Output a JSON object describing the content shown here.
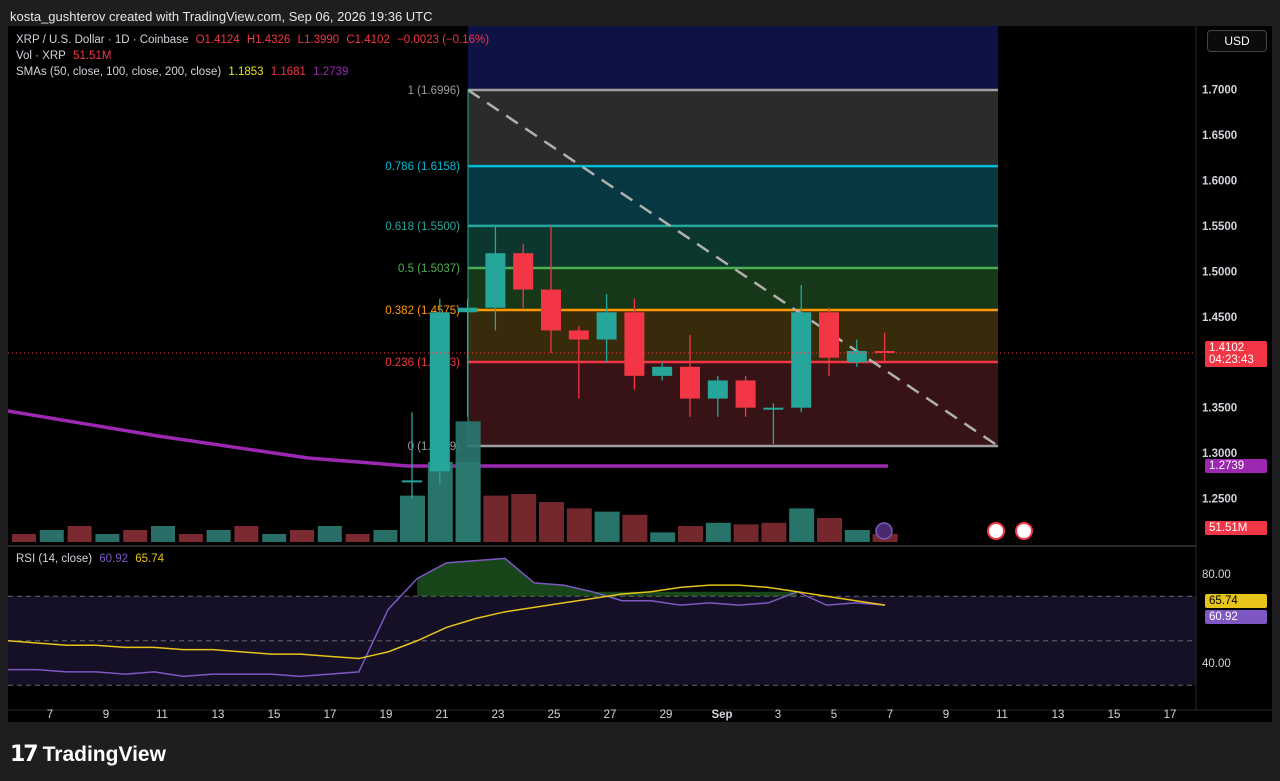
{
  "credit": "kosta_gushterov created with TradingView.com, Sep 06, 2026 19:36 UTC",
  "legend": {
    "symbol": "XRP / U.S. Dollar · 1D · Coinbase",
    "open": "O1.4124",
    "high": "H1.4326",
    "low": "L1.3990",
    "close": "C1.4102",
    "change": "−0.0023 (−0.16%)",
    "vol_label": "Vol · XRP",
    "vol_value": "51.51M",
    "sma_label": "SMAs (50, close, 100, close, 200, close)",
    "sma50": "1.1853",
    "sma100": "1.1681",
    "sma200": "1.2739",
    "rsi_label": "RSI (14, close)",
    "rsi_value": "60.92",
    "rsi_ma": "65.74"
  },
  "currency_button": "USD",
  "price_scale": [
    "1.7000",
    "1.6500",
    "1.6000",
    "1.5500",
    "1.5000",
    "1.4500",
    "1.3500",
    "1.3000",
    "1.2500"
  ],
  "rsi_scale": [
    "80.00",
    "40.00"
  ],
  "price_tags": {
    "last": "1.4102",
    "countdown": "04:23:43",
    "sma200": "1.2739",
    "volume": "51.51M",
    "rsi_ma": "65.74",
    "rsi": "60.92"
  },
  "time_axis": [
    "7",
    "9",
    "11",
    "13",
    "15",
    "17",
    "19",
    "21",
    "23",
    "25",
    "27",
    "29",
    "Sep",
    "3",
    "5",
    "7",
    "9",
    "11",
    "13",
    "15",
    "17"
  ],
  "fib_levels": [
    {
      "label": "1 (1.6996)",
      "price": 1.6996,
      "color": "#9e9e9e"
    },
    {
      "label": "0.786 (1.6158)",
      "price": 1.6158,
      "color": "#00bcd4"
    },
    {
      "label": "0.618 (1.5500)",
      "price": 1.55,
      "color": "#26a69a"
    },
    {
      "label": "0.5 (1.5037)",
      "price": 1.5037,
      "color": "#4caf50"
    },
    {
      "label": "0.382 (1.4575)",
      "price": 1.4575,
      "color": "#ff9800"
    },
    {
      "label": "0.236 (1.4003)",
      "price": 1.4003,
      "color": "#f23645"
    },
    {
      "label": "0 (1.3079)",
      "price": 1.3079,
      "color": "#9e9e9e"
    }
  ],
  "colors": {
    "up": "#26a69a",
    "down": "#f23645",
    "sma200": "#9c27b0",
    "rsi": "#7e57c2",
    "rsi_ma": "#e6c419",
    "background": "#000000"
  },
  "chart_data": {
    "type": "candlestick",
    "candles": [
      {
        "date": "Aug 20",
        "open": 1.27,
        "high": 1.345,
        "low": 1.25,
        "close": 1.27
      },
      {
        "date": "Aug 21",
        "open": 1.28,
        "high": 1.47,
        "low": 1.265,
        "close": 1.455
      },
      {
        "date": "Aug 22",
        "open": 1.455,
        "high": 1.47,
        "low": 1.34,
        "close": 1.46
      },
      {
        "date": "Aug 23",
        "open": 1.46,
        "high": 1.55,
        "low": 1.435,
        "close": 1.52
      },
      {
        "date": "Aug 24",
        "open": 1.52,
        "high": 1.53,
        "low": 1.46,
        "close": 1.48
      },
      {
        "date": "Aug 25",
        "open": 1.48,
        "high": 1.55,
        "low": 1.41,
        "close": 1.435
      },
      {
        "date": "Aug 26",
        "open": 1.435,
        "high": 1.44,
        "low": 1.36,
        "close": 1.425
      },
      {
        "date": "Aug 27",
        "open": 1.425,
        "high": 1.475,
        "low": 1.4,
        "close": 1.455
      },
      {
        "date": "Aug 28",
        "open": 1.455,
        "high": 1.47,
        "low": 1.37,
        "close": 1.385
      },
      {
        "date": "Aug 29",
        "open": 1.385,
        "high": 1.4,
        "low": 1.38,
        "close": 1.395
      },
      {
        "date": "Aug 30",
        "open": 1.395,
        "high": 1.43,
        "low": 1.34,
        "close": 1.36
      },
      {
        "date": "Aug 31",
        "open": 1.36,
        "high": 1.385,
        "low": 1.34,
        "close": 1.38
      },
      {
        "date": "Sep 1",
        "open": 1.38,
        "high": 1.385,
        "low": 1.34,
        "close": 1.35
      },
      {
        "date": "Sep 2",
        "open": 1.35,
        "high": 1.355,
        "low": 1.31,
        "close": 1.35
      },
      {
        "date": "Sep 3",
        "open": 1.35,
        "high": 1.485,
        "low": 1.345,
        "close": 1.455
      },
      {
        "date": "Sep 4",
        "open": 1.455,
        "high": 1.46,
        "low": 1.385,
        "close": 1.405
      },
      {
        "date": "Sep 5",
        "open": 1.4,
        "high": 1.425,
        "low": 1.395,
        "close": 1.4124
      },
      {
        "date": "Sep 6",
        "open": 1.4124,
        "high": 1.4326,
        "low": 1.399,
        "close": 1.4102
      }
    ],
    "volume_up": [
      true,
      true,
      true,
      false,
      false,
      false,
      false,
      true,
      false,
      true,
      false,
      true,
      false,
      false,
      true,
      false,
      true,
      false
    ],
    "volume_rel": [
      0.58,
      1.0,
      1.0,
      0.58,
      0.6,
      0.5,
      0.42,
      0.38,
      0.34,
      0.12,
      0.2,
      0.24,
      0.22,
      0.24,
      0.42,
      0.3,
      0.15,
      0.1
    ],
    "rsi": [
      37,
      37,
      36,
      36,
      35,
      36,
      34,
      35,
      35,
      35,
      34,
      35,
      36,
      64,
      78,
      85,
      86,
      87,
      76,
      75,
      72,
      68,
      68,
      66,
      67,
      66,
      67,
      72,
      66,
      67,
      66
    ],
    "rsi_ma": [
      50,
      49,
      48,
      48,
      47,
      47,
      46,
      46,
      45,
      44,
      44,
      43,
      42,
      45,
      50,
      56,
      60,
      63,
      65,
      67,
      69,
      71,
      72,
      74,
      75,
      75,
      74,
      72,
      70,
      68,
      66
    ],
    "ylim": [
      1.2,
      1.77
    ]
  }
}
